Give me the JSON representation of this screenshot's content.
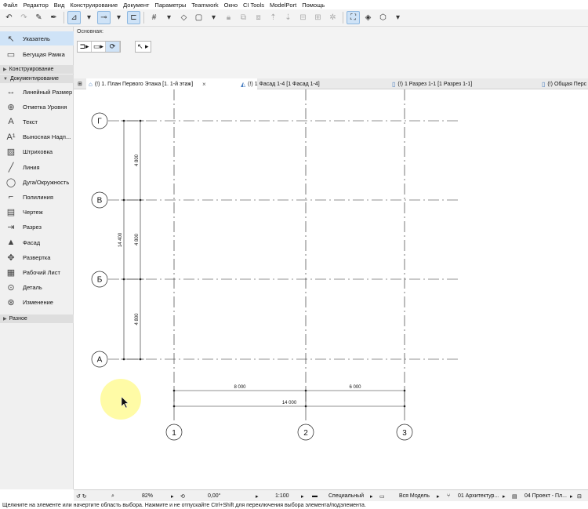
{
  "menu": [
    "Файл",
    "Редактор",
    "Вид",
    "Конструирование",
    "Документ",
    "Параметры",
    "Teamwork",
    "Окно",
    "CI Tools",
    "ModelPort",
    "Помощь"
  ],
  "infobox": {
    "label": "Основная:"
  },
  "toolbox": {
    "tools_top": [
      {
        "label": "Указатель",
        "icon": "pointer-icon",
        "glyph": "↖"
      },
      {
        "label": "Бегущая Рамка",
        "icon": "marquee-icon",
        "glyph": "▭"
      }
    ],
    "categories": {
      "construction": "Конструирование",
      "documentation": "Документирование",
      "misc": "Разное"
    },
    "doc_tools": [
      {
        "label": "Линейный Размер",
        "icon": "linear-dimension-icon",
        "glyph": "↔"
      },
      {
        "label": "Отметка Уровня",
        "icon": "level-dimension-icon",
        "glyph": "⊕"
      },
      {
        "label": "Текст",
        "icon": "text-icon",
        "glyph": "A"
      },
      {
        "label": "Выносная Надп...",
        "icon": "label-icon",
        "glyph": "A¹"
      },
      {
        "label": "Штриховка",
        "icon": "fill-icon",
        "glyph": "▨"
      },
      {
        "label": "Линия",
        "icon": "line-icon",
        "glyph": "╱"
      },
      {
        "label": "Дуга/Окружность",
        "icon": "arc-circle-icon",
        "glyph": "◯"
      },
      {
        "label": "Полилиния",
        "icon": "polyline-icon",
        "glyph": "⌐"
      },
      {
        "label": "Чертеж",
        "icon": "drawing-icon",
        "glyph": "▤"
      },
      {
        "label": "Разрез",
        "icon": "section-icon",
        "glyph": "⇥"
      },
      {
        "label": "Фасад",
        "icon": "elevation-icon",
        "glyph": "▲"
      },
      {
        "label": "Развертка",
        "icon": "interior-elevation-icon",
        "glyph": "✥"
      },
      {
        "label": "Рабочий Лист",
        "icon": "worksheet-icon",
        "glyph": "▦"
      },
      {
        "label": "Деталь",
        "icon": "detail-icon",
        "glyph": "⊙"
      },
      {
        "label": "Изменение",
        "icon": "change-icon",
        "glyph": "⊛"
      }
    ]
  },
  "tabs": [
    {
      "label": "(!) 1. План Первого Этажа [1. 1-й этаж]",
      "close": "×"
    },
    {
      "label": "(!) 1 Фасад 1-4 [1 Фасад 1-4]"
    },
    {
      "label": "(!) 1 Разрез 1-1 [1 Разрез 1-1]"
    },
    {
      "label": "(!) Общая Перс"
    }
  ],
  "drawing": {
    "row_axes": [
      "Г",
      "В",
      "Б",
      "А"
    ],
    "col_axes": [
      "1",
      "2",
      "3"
    ],
    "dim_segments_v": [
      "4 800",
      "4 800",
      "4 800"
    ],
    "dim_total_v": "14 400",
    "dim_segments_h": [
      "8 000",
      "6 000"
    ],
    "dim_total_h": "14 000"
  },
  "bottombar": {
    "zoom": "82%",
    "angle": "0,00°",
    "scale": "1:100",
    "pen_set": "Специальный",
    "model_view": "Вся Модель",
    "layer_combo": "01 Архитектур...",
    "dim_style": "04 Проект - Пл..."
  },
  "status_text": "Щелкните на элементе или начертите область выбора. Нажмите и не отпускайте Ctrl+Shift для переключения выбора элемента/подэлемента.",
  "colors": {
    "selection": "#cfe3f7",
    "cursor_highlight": "#fffb9c",
    "tab_icon": "#4a7fc1"
  }
}
